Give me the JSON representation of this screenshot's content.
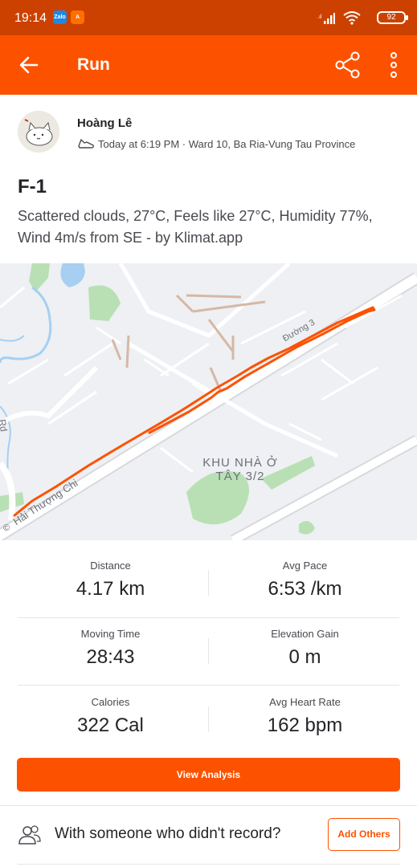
{
  "status_bar": {
    "time": "19:14",
    "apps": [
      "Zalo",
      "A"
    ],
    "battery": "92"
  },
  "app_bar": {
    "title": "Run",
    "icons": [
      "back-arrow-icon",
      "share-icon",
      "more-vertical-icon"
    ]
  },
  "athlete": {
    "name": "Hoàng Lê",
    "meta": "Today at 6:19 PM · Ward 10, Ba Ria-Vung Tau Province"
  },
  "activity": {
    "title": "F-1",
    "description": "Scattered clouds, 27°C, Feels like 27°C, Humidity 77%, Wind 4m/s from SE - by Klimat.app"
  },
  "map": {
    "labels": {
      "district_line1": "KHU NHÀ Ở",
      "district_line2": "TÂY 3/2",
      "road1": "Hải Thượng Chi",
      "road_top": "Đường 3",
      "edge": "Rd"
    },
    "copyright": "©",
    "route_color": "#fc5200"
  },
  "stats": [
    {
      "label": "Distance",
      "value": "4.17 km"
    },
    {
      "label": "Avg Pace",
      "value": "6:53 /km"
    },
    {
      "label": "Moving Time",
      "value": "28:43"
    },
    {
      "label": "Elevation Gain",
      "value": "0 m"
    },
    {
      "label": "Calories",
      "value": "322 Cal"
    },
    {
      "label": "Avg Heart Rate",
      "value": "162 bpm"
    }
  ],
  "actions": {
    "view_analysis": "View Analysis",
    "with_someone": "With someone who didn't record?",
    "add_others": "Add Others"
  },
  "colors": {
    "brand": "#fc5200",
    "status_bar": "#cc4100"
  }
}
